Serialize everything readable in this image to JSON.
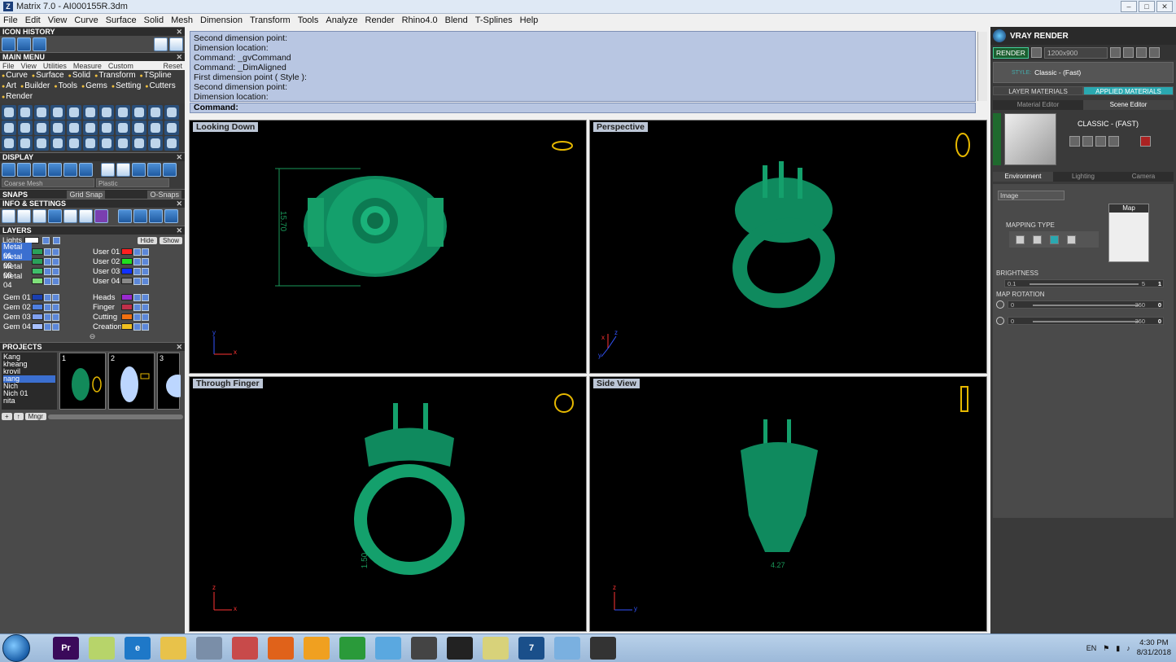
{
  "window": {
    "title": "Matrix 7.0 - AI000155R.3dm",
    "controls": [
      "–",
      "□",
      "✕"
    ]
  },
  "menubar": [
    "File",
    "Edit",
    "View",
    "Curve",
    "Surface",
    "Solid",
    "Mesh",
    "Dimension",
    "Transform",
    "Tools",
    "Analyze",
    "Render",
    "Rhino4.0",
    "Blend",
    "T-Splines",
    "Help"
  ],
  "left": {
    "icon_history": "ICON HISTORY",
    "main_menu": "MAIN MENU",
    "menu_tabs": [
      "File",
      "View",
      "Utilities",
      "Measure",
      "Custom",
      "Reset"
    ],
    "categories": [
      "Curve",
      "Surface",
      "Solid",
      "Transform",
      "TSpline",
      "Art",
      "Builder",
      "Tools",
      "Gems",
      "Setting",
      "Cutters",
      "Render"
    ],
    "display": "DISPLAY",
    "display_mode": "Coarse Mesh",
    "display_material": "Plastic",
    "snaps": "SNAPS",
    "grid_snap": "Grid Snap",
    "o_snaps": "O-Snaps",
    "info_settings": "INFO & SETTINGS",
    "layers_title": "LAYERS",
    "lights": "Lights",
    "hide": "Hide",
    "show": "Show",
    "layers_left": [
      {
        "name": "Metal 01",
        "color": "#2aa15a"
      },
      {
        "name": "Metal 02",
        "color": "#2aa15a"
      },
      {
        "name": "Metal 03",
        "color": "#3fbf6a"
      },
      {
        "name": "Metal 04",
        "color": "#7fe07a"
      }
    ],
    "layers_right": [
      {
        "name": "User 01",
        "color": "#ff2020"
      },
      {
        "name": "User 02",
        "color": "#20e020"
      },
      {
        "name": "User 03",
        "color": "#1030ff"
      },
      {
        "name": "User 04",
        "color": "#888888"
      }
    ],
    "gems_left": [
      {
        "name": "Gem 01",
        "color": "#1a3fb0"
      },
      {
        "name": "Gem 02",
        "color": "#4f7fe0"
      },
      {
        "name": "Gem 03",
        "color": "#7fa0f0"
      },
      {
        "name": "Gem 04",
        "color": "#a8c0ff"
      }
    ],
    "gems_right": [
      {
        "name": "Heads",
        "color": "#9a2ad0"
      },
      {
        "name": "Finger",
        "color": "#c0304a"
      },
      {
        "name": "Cutting",
        "color": "#f07010"
      },
      {
        "name": "Creation",
        "color": "#f0c020"
      }
    ],
    "projects_title": "PROJECTS",
    "projects": [
      "Kang",
      "kheang",
      "krovil",
      "nang",
      "Nich",
      "Nich 01",
      "nita"
    ],
    "project_selected": "nang",
    "thumbs": [
      "1",
      "2",
      "3"
    ],
    "mngr": "Mngr"
  },
  "command": {
    "history": [
      "Second dimension point:",
      "Dimension location:",
      "Command: _gvCommand",
      "Command: _DimAligned",
      "First dimension point ( Style ):",
      "Second dimension point:",
      "Dimension location:"
    ],
    "prompt": "Command:"
  },
  "viewports": {
    "top_left": {
      "label": "Looking Down",
      "dim": "15.70",
      "axis_a": "y",
      "axis_b": "x"
    },
    "top_right": {
      "label": "Perspective",
      "axis_a": "z",
      "axis_b": "x",
      "axis_c": "y"
    },
    "bottom_left": {
      "label": "Through Finger",
      "dim": "1.50",
      "axis_a": "z",
      "axis_b": "x"
    },
    "bottom_right": {
      "label": "Side View",
      "dim": "4.27",
      "axis_a": "z",
      "axis_b": "y"
    }
  },
  "right": {
    "title": "VRAY RENDER",
    "render_btn": "RENDER",
    "resolution": "1200x900",
    "style_label": "STYLE:",
    "style_value": "Classic - (Fast)",
    "layer_materials": "LAYER MATERIALS",
    "applied_materials": "APPLIED MATERIALS",
    "material_editor": "Material Editor",
    "scene_editor": "Scene Editor",
    "material_name": "CLASSIC - (FAST)",
    "env_tabs": [
      "Environment",
      "Lighting",
      "Camera"
    ],
    "env_source": "Image",
    "map_label": "Map",
    "mapping_type": "MAPPING TYPE",
    "brightness": "BRIGHTNESS",
    "brightness_min": "0.1",
    "brightness_max": "5",
    "brightness_val": "1",
    "map_rotation": "MAP ROTATION",
    "rot1_min": "0",
    "rot1_max": "360",
    "rot1_val": "0",
    "rot2_min": "0",
    "rot2_max": "360",
    "rot2_val": "0"
  },
  "taskbar": {
    "apps": [
      {
        "name": "premiere",
        "label": "Pr",
        "color": "#3a0a5a"
      },
      {
        "name": "folder-green",
        "label": "",
        "color": "#b7d46a"
      },
      {
        "name": "ie",
        "label": "e",
        "color": "#1e78c8"
      },
      {
        "name": "explorer",
        "label": "",
        "color": "#e8c24a"
      },
      {
        "name": "calculator",
        "label": "",
        "color": "#7a8ea8"
      },
      {
        "name": "snipping",
        "label": "",
        "color": "#c84a4a"
      },
      {
        "name": "firefox",
        "label": "",
        "color": "#e0621a"
      },
      {
        "name": "media-player",
        "label": "",
        "color": "#f0a020"
      },
      {
        "name": "chrome",
        "label": "",
        "color": "#2a9a3a"
      },
      {
        "name": "app-blue",
        "label": "",
        "color": "#5aa8e0"
      },
      {
        "name": "tool",
        "label": "",
        "color": "#444444"
      },
      {
        "name": "person",
        "label": "",
        "color": "#222222"
      },
      {
        "name": "notes",
        "label": "",
        "color": "#d8d27a"
      },
      {
        "name": "matrix",
        "label": "7",
        "color": "#1a4f8a"
      },
      {
        "name": "paint",
        "label": "",
        "color": "#7ab0e0"
      },
      {
        "name": "render",
        "label": "",
        "color": "#333333"
      }
    ],
    "lang": "EN",
    "time": "4:30 PM",
    "date": "8/31/2018"
  }
}
